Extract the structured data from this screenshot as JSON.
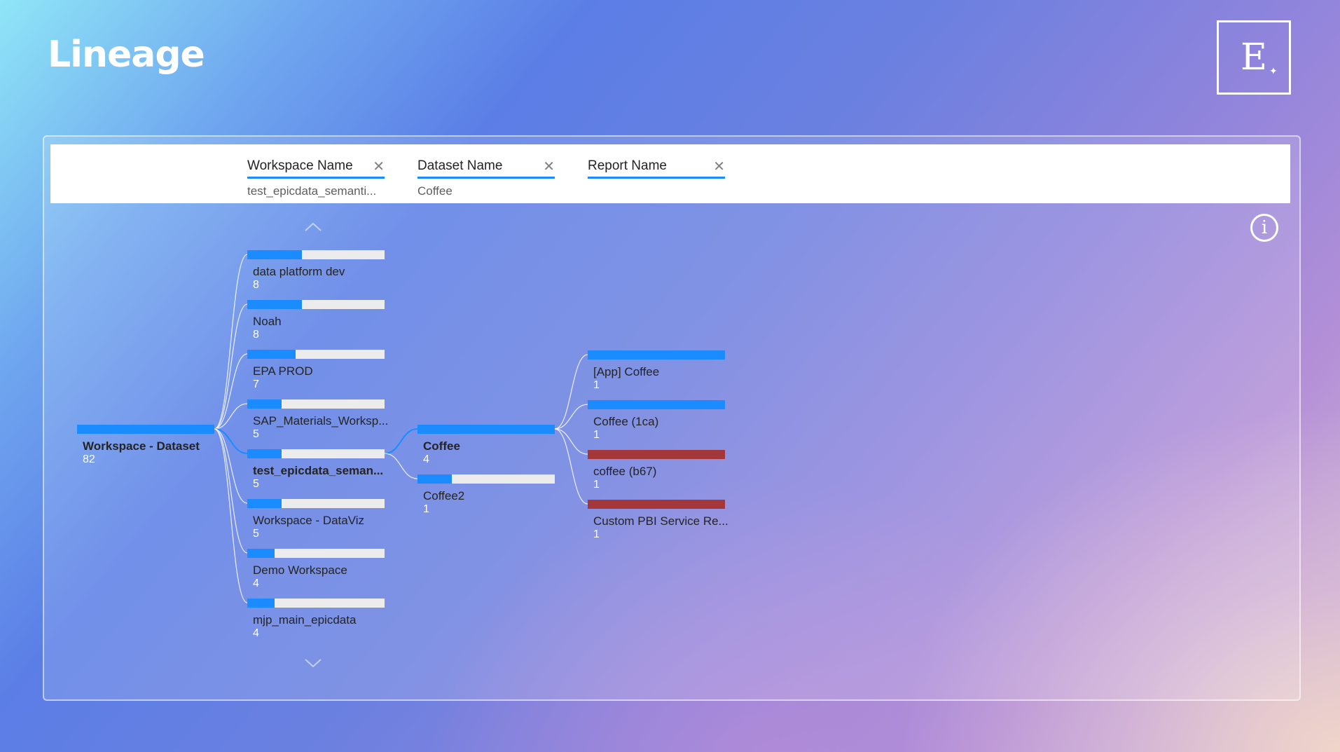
{
  "page": {
    "title": "Lineage"
  },
  "logo": {
    "letter": "E",
    "accent": "✦"
  },
  "filters": [
    {
      "label": "Workspace Name",
      "value": "test_epicdata_semanti..."
    },
    {
      "label": "Dataset Name",
      "value": "Coffee"
    },
    {
      "label": "Report Name",
      "value": ""
    }
  ],
  "info_icon": "info-icon",
  "colors": {
    "bar_fill": "#1a8cff",
    "bar_alert": "#a4373a",
    "bar_track": "#ececec"
  },
  "tree": {
    "root": {
      "label": "Workspace - Dataset",
      "count": "82"
    },
    "workspaces": [
      {
        "label": "data platform dev",
        "count": "8",
        "fill": 0.4
      },
      {
        "label": "Noah",
        "count": "8",
        "fill": 0.4
      },
      {
        "label": "EPA PROD",
        "count": "7",
        "fill": 0.35
      },
      {
        "label": "SAP_Materials_Worksp...",
        "count": "5",
        "fill": 0.25
      },
      {
        "label": "test_epicdata_seman...",
        "count": "5",
        "fill": 0.25,
        "selected": true
      },
      {
        "label": "Workspace - DataViz",
        "count": "5",
        "fill": 0.25
      },
      {
        "label": "Demo Workspace",
        "count": "4",
        "fill": 0.2
      },
      {
        "label": "mjp_main_epicdata",
        "count": "4",
        "fill": 0.2
      }
    ],
    "datasets": [
      {
        "label": "Coffee",
        "count": "4",
        "fill": 1.0,
        "selected": true
      },
      {
        "label": "Coffee2",
        "count": "1",
        "fill": 0.25
      }
    ],
    "reports": [
      {
        "label": "[App] Coffee",
        "count": "1",
        "fill": 1.0,
        "color": "#1a8cff"
      },
      {
        "label": "Coffee (1ca)",
        "count": "1",
        "fill": 1.0,
        "color": "#1a8cff"
      },
      {
        "label": "coffee (b67)",
        "count": "1",
        "fill": 1.0,
        "color": "#a4373a"
      },
      {
        "label": "Custom PBI Service Re...",
        "count": "1",
        "fill": 1.0,
        "color": "#a4373a"
      }
    ]
  }
}
